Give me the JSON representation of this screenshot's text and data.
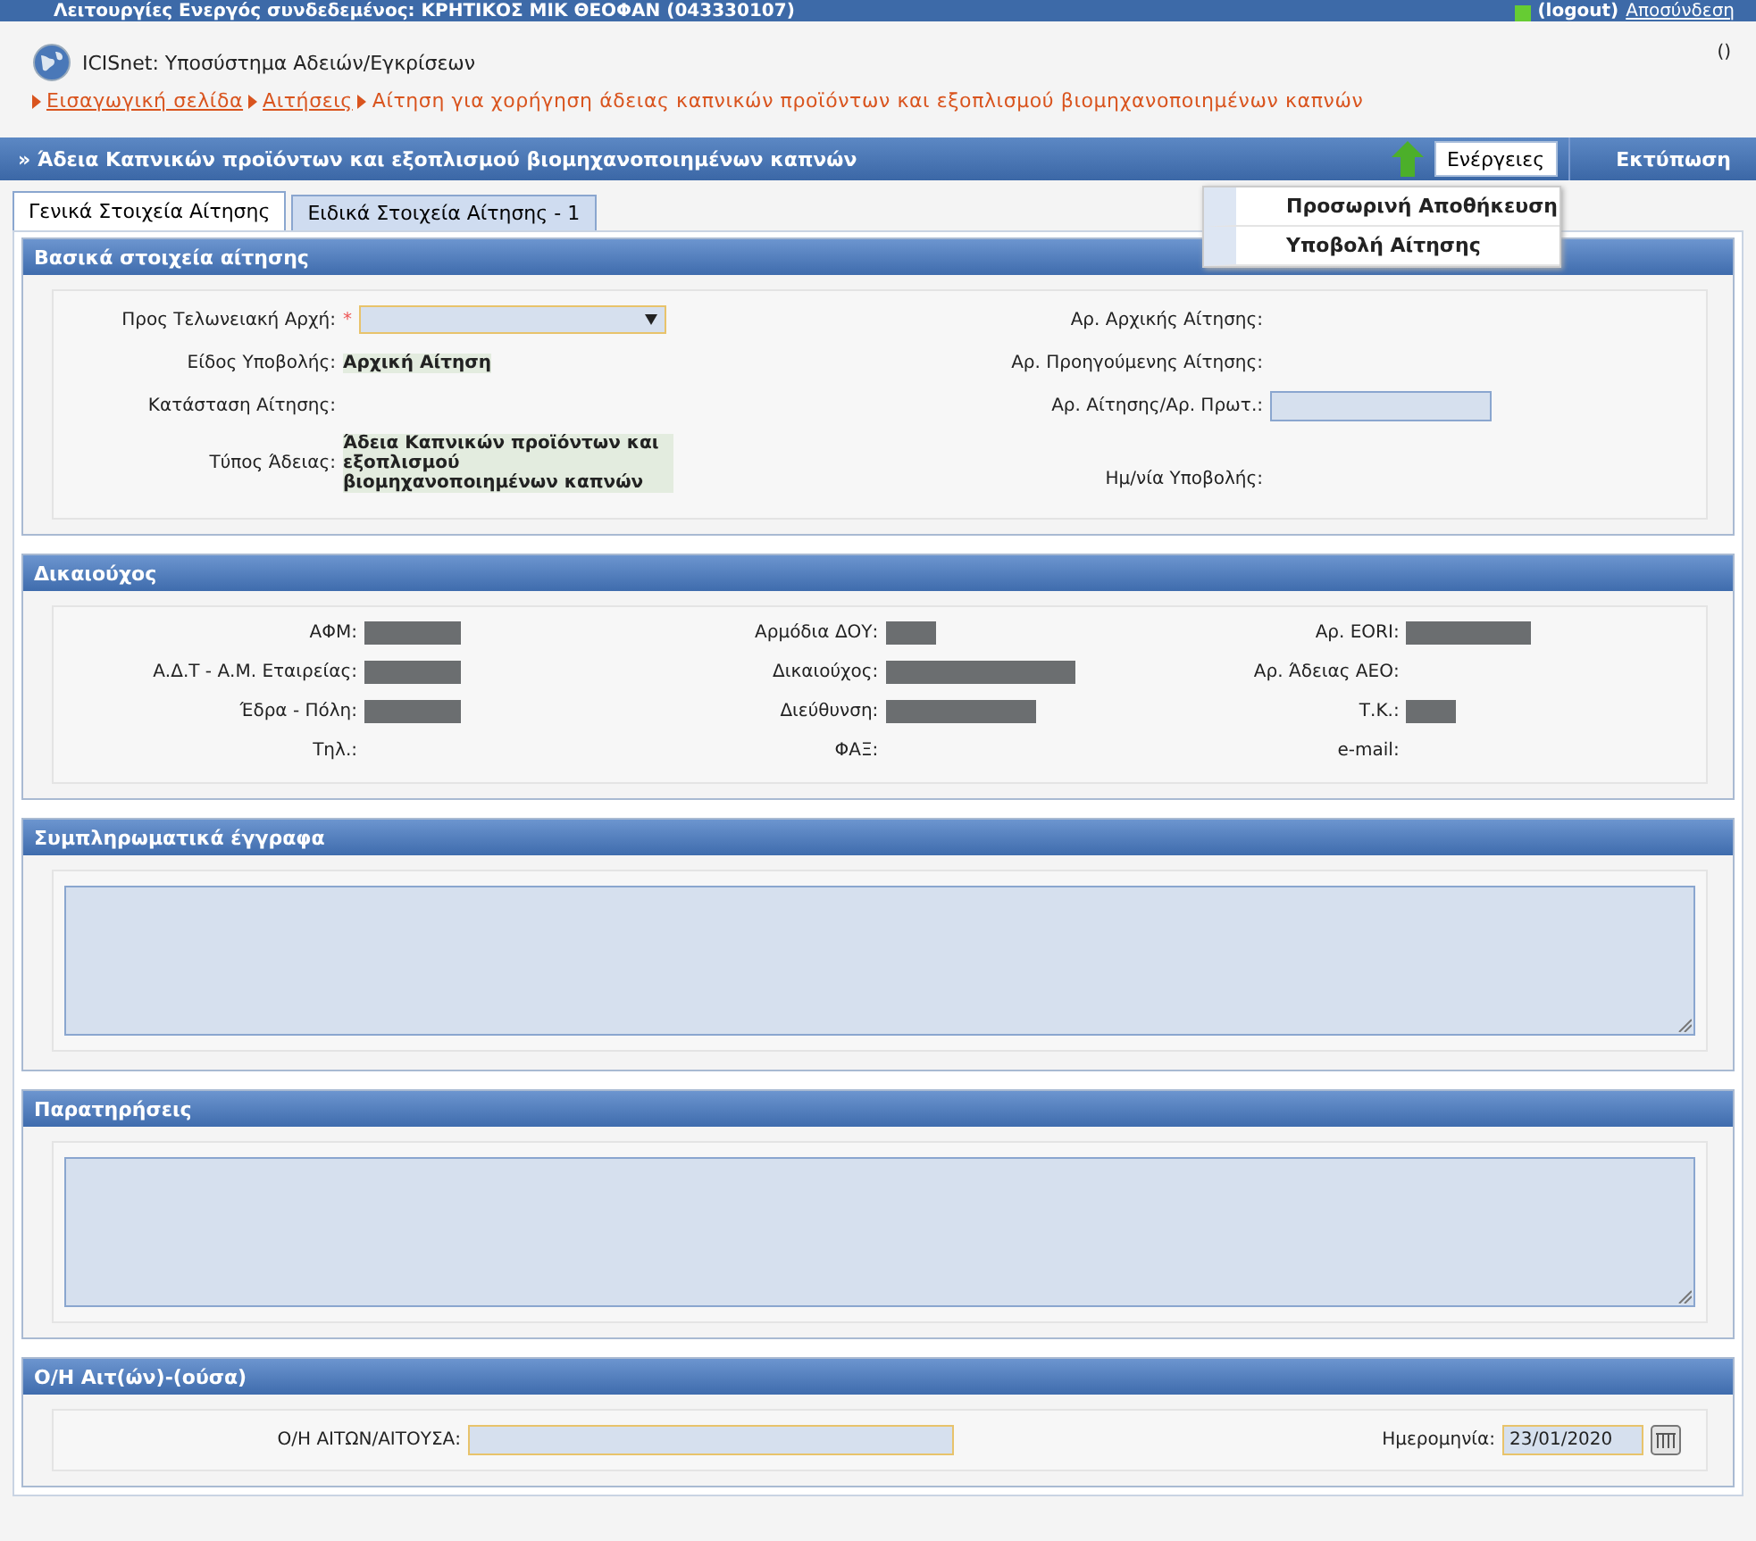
{
  "top_bar": {
    "text": "Λειτουργίες  Ενεργός συνδεδεμένος: ΚΡΗΤΙΚΟΣ ΜΙΚ ΘΕΟΦΑΝ (043330107)",
    "status_text": "(logout)",
    "logout_link": "Αποσύνδεση"
  },
  "header": {
    "app_title": "ICISnet: Υποσύστημα Αδειών/Εγκρίσεων",
    "right_text": "()"
  },
  "breadcrumb": [
    {
      "label": "Εισαγωγική σελίδα",
      "link": true
    },
    {
      "label": "Αιτήσεις",
      "link": true
    },
    {
      "label": "Αίτηση για χορήγηση άδειας καπνικών προϊόντων και εξοπλισμού βιομηχανοποιημένων καπνών",
      "link": false
    }
  ],
  "title_bar": {
    "title": "» Άδεια Καπνικών προϊόντων και εξοπλισμού βιομηχανοποιημένων καπνών",
    "actions_button": "Ενέργειες",
    "print_button": "Εκτύπωση"
  },
  "actions_menu": {
    "expanded": true,
    "items": [
      "Προσωρινή Αποθήκευση",
      "Υποβολή Αίτησης"
    ]
  },
  "tabs": [
    {
      "label": "Γενικά Στοιχεία Αίτησης",
      "selected": true
    },
    {
      "label": "Ειδικά Στοιχεία Αίτησης - 1",
      "selected": false
    }
  ],
  "basic": {
    "title": "Βασικά στοιχεία αίτησης",
    "left": [
      {
        "label": "Προς Τελωνειακή Αρχή:",
        "required_mark": "*",
        "kind": "select"
      },
      {
        "label": "Είδος Υποβολής:",
        "kind": "value",
        "value": "Αρχική Αίτηση"
      },
      {
        "label": "Κατάσταση Αίτησης:",
        "kind": "empty"
      },
      {
        "label": "Τύπος Άδειας:",
        "kind": "value",
        "value": "Άδεια Καπνικών προϊόντων και εξοπλισμού βιομηχανοποιημένων καπνών"
      }
    ],
    "right": [
      {
        "label": "Αρ. Αρχικής Αίτησης:",
        "kind": "empty"
      },
      {
        "label": "Αρ. Προηγούμενης Αίτησης:",
        "kind": "empty"
      },
      {
        "label": "Αρ. Αίτησης/Αρ. Πρωτ.:",
        "kind": "input"
      },
      {
        "label": "Ημ/νία Υποβολής:",
        "kind": "empty"
      }
    ]
  },
  "beneficiary": {
    "title": "Δικαιούχος",
    "fields": [
      {
        "label": "ΑΦΜ:",
        "kind": "redacted"
      },
      {
        "label": "Αρμόδια ΔΟΥ:",
        "kind": "redacted"
      },
      {
        "label": "Αρ. EORI:",
        "kind": "redacted"
      },
      {
        "label": "Α.Δ.Τ - Α.Μ. Εταιρείας:",
        "kind": "redacted"
      },
      {
        "label": "Δικαιούχος:",
        "kind": "redacted"
      },
      {
        "label": "Αρ. Άδειας ΑΕΟ:",
        "kind": "empty"
      },
      {
        "label": "Έδρα - Πόλη:",
        "kind": "redacted"
      },
      {
        "label": "Διεύθυνση:",
        "kind": "redacted"
      },
      {
        "label": "Τ.Κ.:",
        "kind": "redacted"
      },
      {
        "label": "Τηλ.:",
        "kind": "empty"
      },
      {
        "label": "ΦΑΞ:",
        "kind": "empty"
      },
      {
        "label": "e-mail:",
        "kind": "empty"
      }
    ]
  },
  "attachments": {
    "title": "Συμπληρωματικά έγγραφα"
  },
  "remarks": {
    "title": "Παρατηρήσεις"
  },
  "applicant": {
    "title": "Ο/Η Αιτ(ών)-(ούσα)",
    "name_label": "Ο/Η ΑΙΤΩΝ/ΑΙΤΟΥΣΑ:",
    "date_label": "Ημερομηνία:",
    "date_value": "23/01/2020"
  }
}
